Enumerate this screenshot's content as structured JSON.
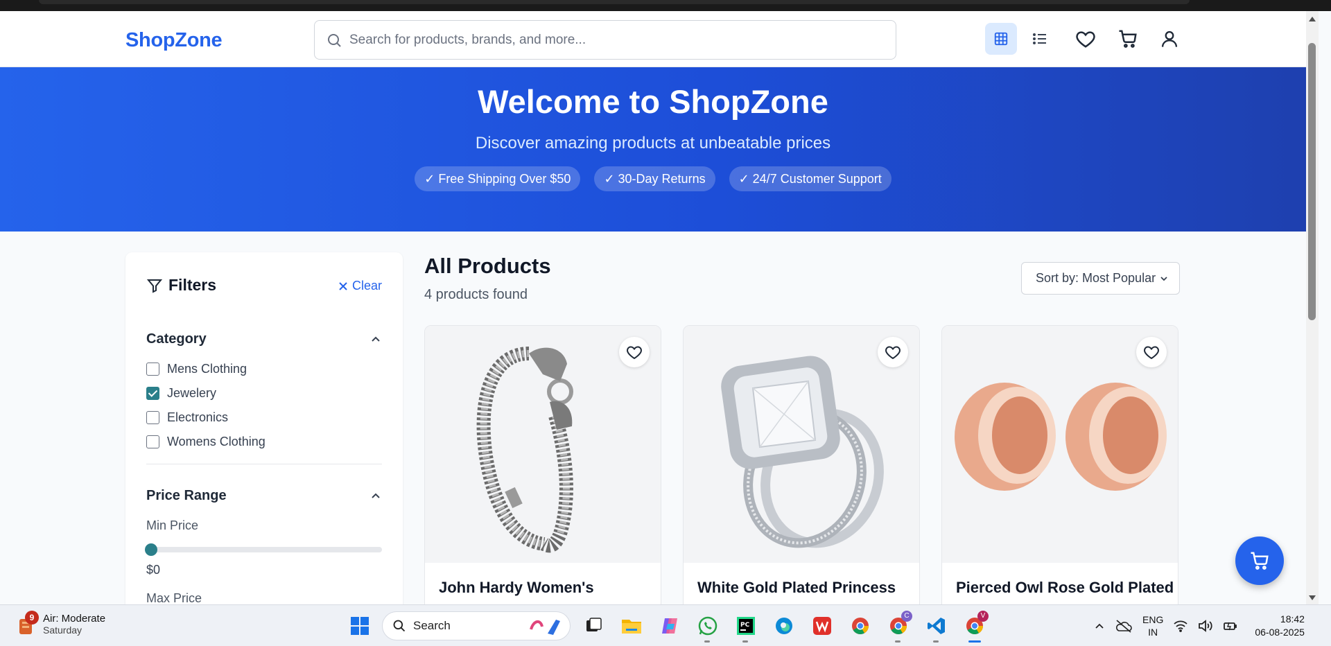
{
  "header": {
    "logo": "ShopZone",
    "search_placeholder": "Search for products, brands, and more..."
  },
  "hero": {
    "title": "Welcome to ShopZone",
    "subtitle": "Discover amazing products at unbeatable prices",
    "pills": [
      "✓ Free Shipping Over $50",
      "✓ 30-Day Returns",
      "✓ 24/7 Customer Support"
    ]
  },
  "filters": {
    "title": "Filters",
    "clear_label": "Clear",
    "category": {
      "title": "Category",
      "items": [
        {
          "label": "Mens Clothing",
          "checked": false
        },
        {
          "label": "Jewelery",
          "checked": true
        },
        {
          "label": "Electronics",
          "checked": false
        },
        {
          "label": "Womens Clothing",
          "checked": false
        }
      ]
    },
    "price_range": {
      "title": "Price Range",
      "min_label": "Min Price",
      "min_value": "$0",
      "max_label": "Max Price"
    }
  },
  "products": {
    "title": "All Products",
    "count": "4 products found",
    "sort_label": "Sort by: Most Popular",
    "items": [
      {
        "name": "John Hardy Women's"
      },
      {
        "name": "White Gold Plated Princess"
      },
      {
        "name": "Pierced Owl Rose Gold Plated"
      }
    ]
  },
  "taskbar": {
    "weather_badge": "9",
    "weather_title": "Air: Moderate",
    "weather_day": "Saturday",
    "search_label": "Search",
    "lang_1": "ENG",
    "lang_2": "IN",
    "time": "18:42",
    "date": "06-08-2025",
    "chrome_badge_1": "C",
    "chrome_badge_2": "V"
  },
  "colors": {
    "brand": "#2563eb",
    "hero_start": "#2563eb",
    "hero_end": "#1e40af",
    "checkbox": "#2a7f8a"
  }
}
